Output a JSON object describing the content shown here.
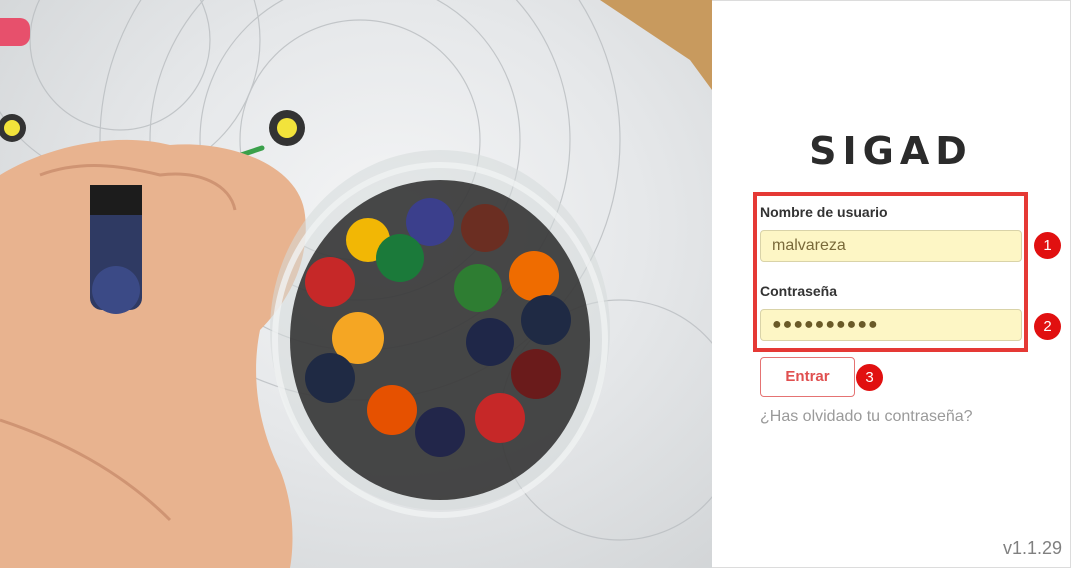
{
  "app": {
    "title": "SIGAD",
    "version": "v1.1.29"
  },
  "login": {
    "username_label": "Nombre de usuario",
    "username_value": "malvareza",
    "password_label": "Contraseña",
    "password_value": "●●●●●●●●●●",
    "submit_label": "Entrar",
    "forgot_link": "¿Has olvidado tu contraseña?"
  },
  "annotations": {
    "badge1": "1",
    "badge2": "2",
    "badge3": "3"
  },
  "colors": {
    "accent": "#e05050",
    "highlight": "#e53935",
    "badge": "#e11010",
    "autofill": "#fdf6c5"
  },
  "illustration": {
    "subject": "crayons-in-jar-photo"
  }
}
